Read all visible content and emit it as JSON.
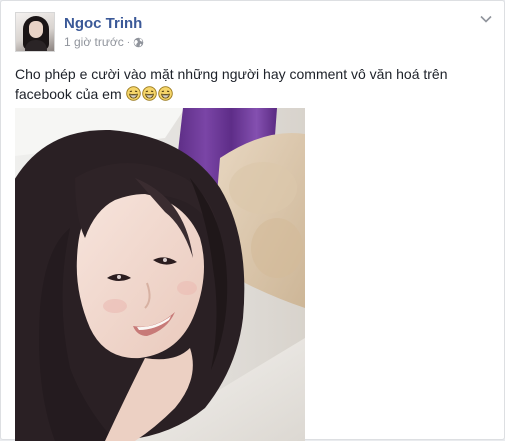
{
  "post": {
    "author": "Ngoc Trinh",
    "time": "1 giờ trước",
    "separator": "·",
    "text": "Cho phép e cười vào mặt những người hay comment vô văn hoá trên facebook của em",
    "emoji_count": 3
  },
  "icons": {
    "audience": "globe-icon",
    "menu": "chevron-down-icon",
    "emoji": "grin-emoji-icon"
  },
  "colors": {
    "name": "#3b5998",
    "meta": "#90949c",
    "text": "#1d2129"
  }
}
